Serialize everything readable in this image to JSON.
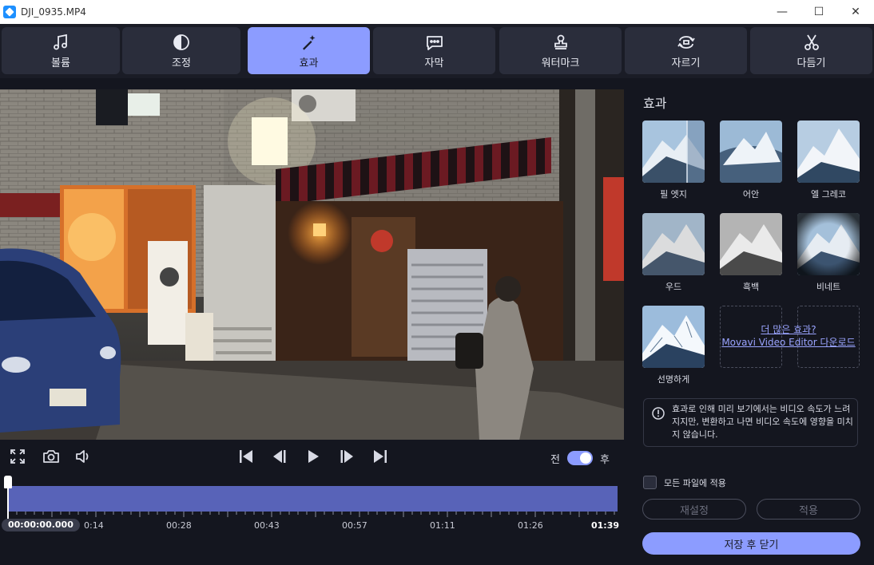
{
  "window": {
    "title": "DJI_0935.MP4",
    "minimize": "—",
    "maximize": "☐",
    "close": "✕"
  },
  "tabs": [
    {
      "label": "볼륨",
      "icon": "music-note-icon",
      "active": false
    },
    {
      "label": "조정",
      "icon": "contrast-icon",
      "active": false
    },
    {
      "label": "효과",
      "icon": "magic-wand-icon",
      "active": true
    },
    {
      "label": "자막",
      "icon": "speech-bubble-icon",
      "active": false
    },
    {
      "label": "워터마크",
      "icon": "stamp-icon",
      "active": false
    },
    {
      "label": "자르기",
      "icon": "rotate-crop-icon",
      "active": false
    },
    {
      "label": "다듬기",
      "icon": "scissors-icon",
      "active": false
    }
  ],
  "player": {
    "before_label": "전",
    "after_label": "후",
    "before_after_enabled": true
  },
  "timeline": {
    "current_time": "00:00:00.000",
    "labels": [
      "0:14",
      "00:28",
      "00:43",
      "00:57",
      "01:11",
      "01:26",
      "01:39"
    ],
    "playhead_fraction": 0
  },
  "panel": {
    "title": "효과",
    "effects": [
      {
        "name": "필 엣지"
      },
      {
        "name": "어안"
      },
      {
        "name": "엘 그레코"
      },
      {
        "name": "우드"
      },
      {
        "name": "흑백"
      },
      {
        "name": "비네트"
      },
      {
        "name": "선명하게"
      }
    ],
    "more_line1": "더 많은 효과?",
    "more_line2": "Movavi Video Editor 다운로드",
    "notice": "효과로 인해 미리 보기에서는 비디오 속도가 느려지지만, 변환하고 나면 비디오 속도에 영향을 미치지 않습니다.",
    "apply_all_label": "모든 파일에 적용",
    "apply_all_checked": false,
    "reset_label": "재설정",
    "apply_label": "적용",
    "save_label": "저장 후 닫기"
  },
  "colors": {
    "accent": "#8c9cff",
    "timeline": "#5863b8",
    "background": "#14161f"
  }
}
